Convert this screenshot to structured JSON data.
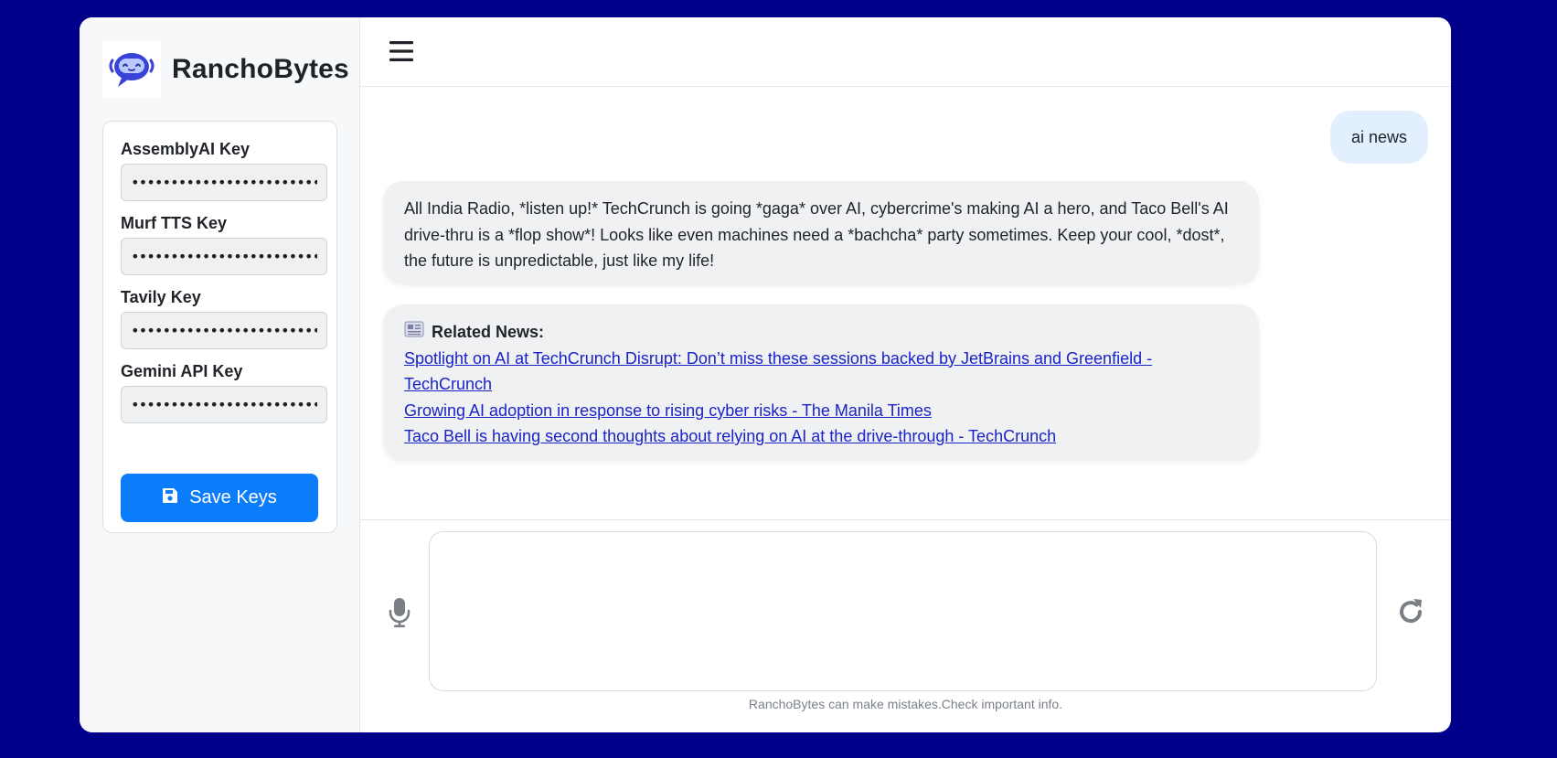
{
  "sidebar": {
    "brand_name": "RanchoBytes",
    "keys": [
      {
        "label": "AssemblyAI Key",
        "value": "••••••••••••••••••••••••••••••••"
      },
      {
        "label": "Murf TTS Key",
        "value": "••••••••••••••••••••••••••••••••••••"
      },
      {
        "label": "Tavily Key",
        "value": "••••••••••••••••••••••••••••••••••••"
      },
      {
        "label": "Gemini API Key",
        "value": "••••••••••••••••••••••••••••••••••••"
      }
    ],
    "save_label": "Save Keys",
    "save_icon": "floppy-disk-icon"
  },
  "header": {
    "menu_icon": "hamburger-menu-icon"
  },
  "chat": {
    "user_message": "ai news",
    "bot_reply": "All India Radio, *listen up!* TechCrunch is going *gaga* over AI, cybercrime's making AI a hero, and Taco Bell's AI drive-thru is a *flop show*! Looks like even machines need a *bachcha* party sometimes. Keep your cool, *dost*, the future is unpredictable, just like my life!",
    "news_heading": "Related News:",
    "news_icon": "newspaper-icon",
    "news_links": [
      "Spotlight on AI at TechCrunch Disrupt: Don’t miss these sessions backed by JetBrains and Greenfield - TechCrunch",
      "Growing AI adoption in response to rising cyber risks - The Manila Times",
      "Taco Bell is having second thoughts about relying on AI at the drive-through - TechCrunch"
    ]
  },
  "composer": {
    "input_value": "",
    "mic_icon": "microphone-icon",
    "refresh_icon": "refresh-icon",
    "disclaimer": "RanchoBytes can make mistakes.Check important info."
  },
  "colors": {
    "background": "#00008b",
    "accent": "#0b7dfb",
    "user_bubble": "#e1efff",
    "bot_bubble": "#f0f1f3",
    "link": "#1a23c9"
  }
}
